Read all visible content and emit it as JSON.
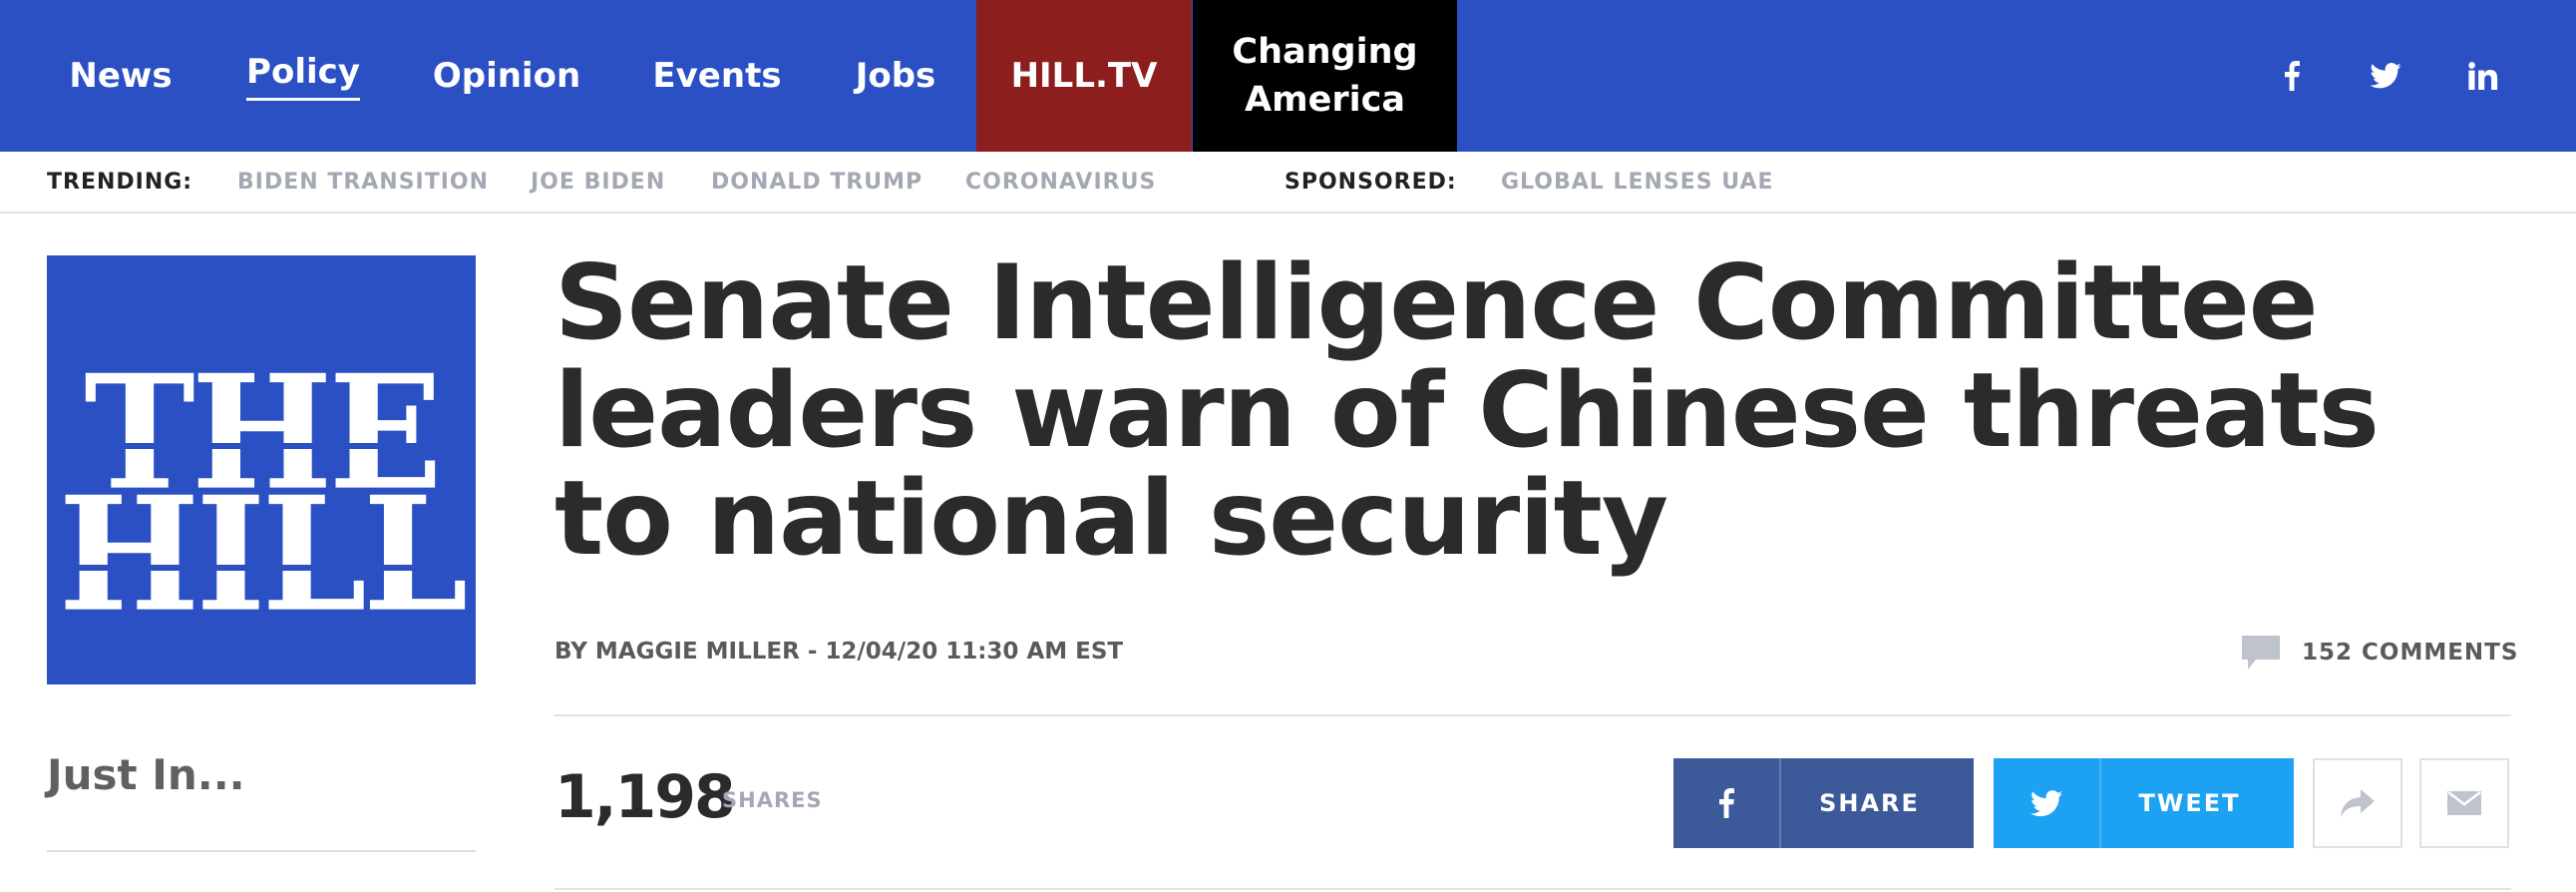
{
  "nav": {
    "items": [
      "News",
      "Policy",
      "Opinion",
      "Events",
      "Jobs"
    ],
    "hilltv": "HILL.TV",
    "changing_line1": "Changing",
    "changing_line2": "America",
    "social_icons": [
      "facebook-icon",
      "twitter-icon",
      "linkedin-icon"
    ]
  },
  "trending": {
    "label": "TRENDING:",
    "links": [
      "BIDEN TRANSITION",
      "JOE BIDEN",
      "DONALD TRUMP",
      "CORONAVIRUS"
    ],
    "sponsored_label": "SPONSORED:",
    "sponsored_link": "GLOBAL LENSES UAE"
  },
  "logo": {
    "line1": "THE",
    "line2": "HILL",
    "color": "#2b50c4"
  },
  "sidebar": {
    "just_in": "Just In..."
  },
  "article": {
    "headline": "Senate Intelligence Committee leaders warn of Chinese threats to national security",
    "byline": "BY MAGGIE MILLER - 12/04/20 11:30 AM EST",
    "comments": "152 COMMENTS",
    "shares_count": "1,198",
    "shares_label": "SHARES",
    "share_fb": "SHARE",
    "share_tw": "TWEET"
  },
  "colors": {
    "brand": "#2b50c4",
    "hilltv": "#8c1e1e",
    "facebook": "#3c5a9a",
    "twitter": "#1da1f2"
  }
}
